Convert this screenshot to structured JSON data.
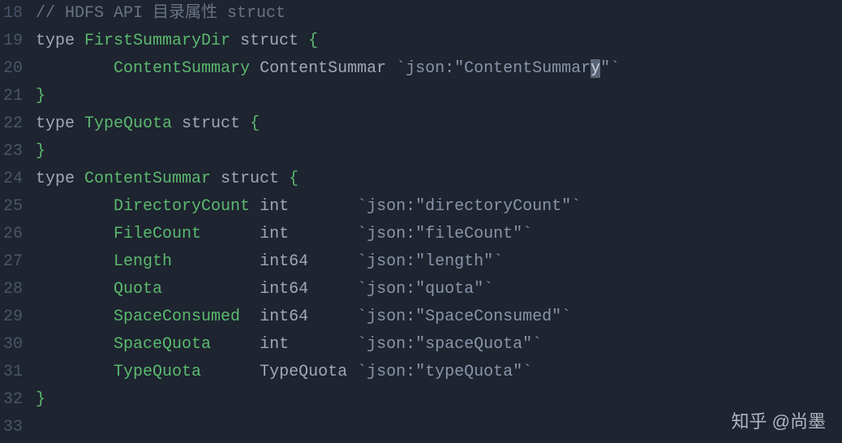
{
  "lines": [
    {
      "num": "18",
      "tokens": [
        {
          "cls": "comment",
          "text": "// HDFS API 目录属性 struct"
        }
      ]
    },
    {
      "num": "19",
      "tokens": [
        {
          "cls": "keyword",
          "text": "type "
        },
        {
          "cls": "type-name",
          "text": "FirstSummaryDir"
        },
        {
          "cls": "keyword",
          "text": " struct "
        },
        {
          "cls": "brace",
          "text": "{"
        }
      ]
    },
    {
      "num": "20",
      "tokens": [
        {
          "cls": "keyword",
          "text": "        "
        },
        {
          "cls": "type-name",
          "text": "ContentSummary"
        },
        {
          "cls": "keyword",
          "text": " "
        },
        {
          "cls": "keyword",
          "text": "ContentSummar"
        },
        {
          "cls": "keyword",
          "text": " "
        },
        {
          "cls": "string",
          "text": "`json:\"ContentSummar"
        },
        {
          "cls": "highlight-char",
          "text": "y"
        },
        {
          "cls": "string",
          "text": "\"`"
        }
      ]
    },
    {
      "num": "21",
      "tokens": [
        {
          "cls": "brace",
          "text": "}"
        }
      ]
    },
    {
      "num": "22",
      "tokens": [
        {
          "cls": "keyword",
          "text": "type "
        },
        {
          "cls": "type-name",
          "text": "TypeQuota"
        },
        {
          "cls": "keyword",
          "text": " struct "
        },
        {
          "cls": "brace",
          "text": "{"
        }
      ]
    },
    {
      "num": "23",
      "tokens": [
        {
          "cls": "brace",
          "text": "}"
        }
      ]
    },
    {
      "num": "24",
      "tokens": [
        {
          "cls": "keyword",
          "text": "type "
        },
        {
          "cls": "type-name",
          "text": "ContentSummar"
        },
        {
          "cls": "keyword",
          "text": " struct "
        },
        {
          "cls": "brace",
          "text": "{"
        }
      ]
    },
    {
      "num": "25",
      "tokens": [
        {
          "cls": "keyword",
          "text": "        "
        },
        {
          "cls": "type-name",
          "text": "DirectoryCount"
        },
        {
          "cls": "keyword",
          "text": " "
        },
        {
          "cls": "type-builtin",
          "text": "int"
        },
        {
          "cls": "keyword",
          "text": "       "
        },
        {
          "cls": "string",
          "text": "`json:\"directoryCount\"`"
        }
      ]
    },
    {
      "num": "26",
      "tokens": [
        {
          "cls": "keyword",
          "text": "        "
        },
        {
          "cls": "type-name",
          "text": "FileCount"
        },
        {
          "cls": "keyword",
          "text": "      "
        },
        {
          "cls": "type-builtin",
          "text": "int"
        },
        {
          "cls": "keyword",
          "text": "       "
        },
        {
          "cls": "string",
          "text": "`json:\"fileCount\"`"
        }
      ]
    },
    {
      "num": "27",
      "tokens": [
        {
          "cls": "keyword",
          "text": "        "
        },
        {
          "cls": "type-name",
          "text": "Length"
        },
        {
          "cls": "keyword",
          "text": "         "
        },
        {
          "cls": "type-builtin",
          "text": "int64"
        },
        {
          "cls": "keyword",
          "text": "     "
        },
        {
          "cls": "string",
          "text": "`json:\"length\"`"
        }
      ]
    },
    {
      "num": "28",
      "tokens": [
        {
          "cls": "keyword",
          "text": "        "
        },
        {
          "cls": "type-name",
          "text": "Quota"
        },
        {
          "cls": "keyword",
          "text": "          "
        },
        {
          "cls": "type-builtin",
          "text": "int64"
        },
        {
          "cls": "keyword",
          "text": "     "
        },
        {
          "cls": "string",
          "text": "`json:\"quota\"`"
        }
      ]
    },
    {
      "num": "29",
      "tokens": [
        {
          "cls": "keyword",
          "text": "        "
        },
        {
          "cls": "type-name",
          "text": "SpaceConsumed"
        },
        {
          "cls": "keyword",
          "text": "  "
        },
        {
          "cls": "type-builtin",
          "text": "int64"
        },
        {
          "cls": "keyword",
          "text": "     "
        },
        {
          "cls": "string",
          "text": "`json:\"SpaceConsumed\"`"
        }
      ]
    },
    {
      "num": "30",
      "tokens": [
        {
          "cls": "keyword",
          "text": "        "
        },
        {
          "cls": "type-name",
          "text": "SpaceQuota"
        },
        {
          "cls": "keyword",
          "text": "     "
        },
        {
          "cls": "type-builtin",
          "text": "int"
        },
        {
          "cls": "keyword",
          "text": "       "
        },
        {
          "cls": "string",
          "text": "`json:\"spaceQuota\"`"
        }
      ]
    },
    {
      "num": "31",
      "tokens": [
        {
          "cls": "keyword",
          "text": "        "
        },
        {
          "cls": "type-name",
          "text": "TypeQuota"
        },
        {
          "cls": "keyword",
          "text": "      "
        },
        {
          "cls": "type-builtin",
          "text": "TypeQuota"
        },
        {
          "cls": "keyword",
          "text": " "
        },
        {
          "cls": "string",
          "text": "`json:\"typeQuota\"`"
        }
      ]
    },
    {
      "num": "32",
      "tokens": [
        {
          "cls": "brace",
          "text": "}"
        }
      ]
    },
    {
      "num": "33",
      "tokens": []
    }
  ],
  "watermark": "知乎 @尚墨"
}
